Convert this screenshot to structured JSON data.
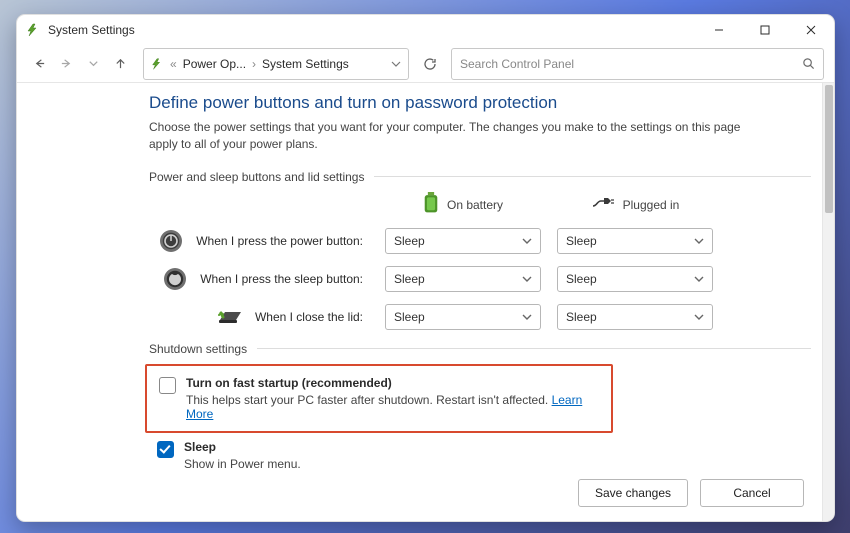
{
  "window": {
    "title": "System Settings"
  },
  "breadcrumb": {
    "prefix": "«",
    "parent": "Power Op...",
    "current": "System Settings"
  },
  "search": {
    "placeholder": "Search Control Panel"
  },
  "page": {
    "title": "Define power buttons and turn on password protection",
    "description": "Choose the power settings that you want for your computer. The changes you make to the settings on this page apply to all of your power plans."
  },
  "section1": {
    "heading": "Power and sleep buttons and lid settings",
    "col_battery": "On battery",
    "col_plugged": "Plugged in",
    "rows": [
      {
        "label": "When I press the power button:",
        "battery": "Sleep",
        "plugged": "Sleep"
      },
      {
        "label": "When I press the sleep button:",
        "battery": "Sleep",
        "plugged": "Sleep"
      },
      {
        "label": "When I close the lid:",
        "battery": "Sleep",
        "plugged": "Sleep"
      }
    ]
  },
  "section2": {
    "heading": "Shutdown settings",
    "fast_startup": {
      "checked": false,
      "title": "Turn on fast startup (recommended)",
      "subtitle": "This helps start your PC faster after shutdown. Restart isn't affected.",
      "learn_more": "Learn More"
    },
    "sleep": {
      "checked": true,
      "title": "Sleep",
      "subtitle": "Show in Power menu."
    }
  },
  "buttons": {
    "save": "Save changes",
    "cancel": "Cancel"
  }
}
